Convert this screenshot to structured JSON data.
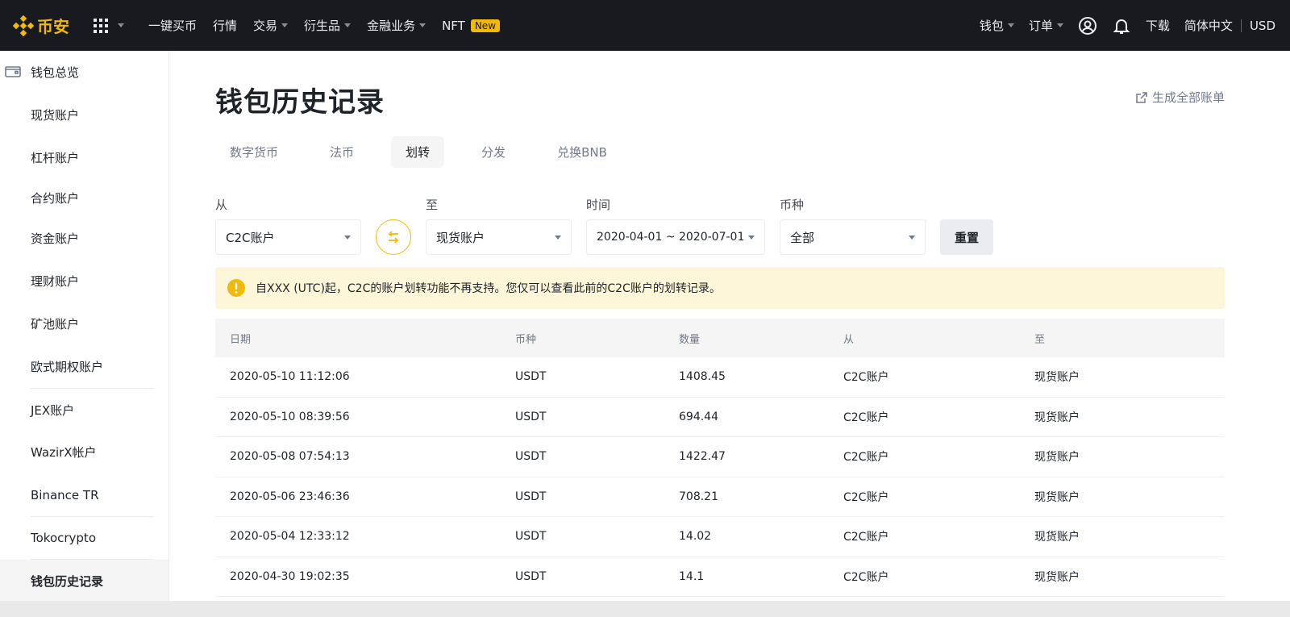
{
  "brand": {
    "name": "币安"
  },
  "topnav": {
    "left": [
      {
        "label": "一键买币",
        "dropdown": false
      },
      {
        "label": "行情",
        "dropdown": false
      },
      {
        "label": "交易",
        "dropdown": true
      },
      {
        "label": "衍生品",
        "dropdown": true
      },
      {
        "label": "金融业务",
        "dropdown": true
      },
      {
        "label": "NFT",
        "dropdown": false,
        "badge": "New"
      }
    ],
    "right": {
      "wallet": "钱包",
      "orders": "订单",
      "download": "下载",
      "language": "简体中文",
      "currency": "USD"
    }
  },
  "sidebar": {
    "items": [
      {
        "label": "钱包总览"
      },
      {
        "label": "现货账户"
      },
      {
        "label": "杠杆账户"
      },
      {
        "label": "合约账户"
      },
      {
        "label": "资金账户"
      },
      {
        "label": "理财账户"
      },
      {
        "label": "矿池账户"
      },
      {
        "label": "欧式期权账户"
      },
      {
        "label": "JEX账户"
      },
      {
        "label": "WazirX帐户"
      },
      {
        "label": "Binance TR"
      },
      {
        "label": "Tokocrypto"
      },
      {
        "label": "钱包历史记录"
      }
    ]
  },
  "page": {
    "title": "钱包历史记录",
    "export_label": "生成全部账单"
  },
  "tabs": [
    {
      "label": "数字货币"
    },
    {
      "label": "法币"
    },
    {
      "label": "划转",
      "active": true
    },
    {
      "label": "分发"
    },
    {
      "label": "兑换BNB"
    }
  ],
  "filters": {
    "from_label": "从",
    "from_value": "C2C账户",
    "to_label": "至",
    "to_value": "现货账户",
    "time_label": "时间",
    "time_value": "2020-04-01 ~ 2020-07-01",
    "coin_label": "币种",
    "coin_value": "全部",
    "reset_label": "重置"
  },
  "notice": {
    "text": "自XXX (UTC)起，C2C的账户划转功能不再支持。您仅可以查看此前的C2C账户的划转记录。"
  },
  "table": {
    "headers": [
      "日期",
      "币种",
      "数量",
      "从",
      "至"
    ],
    "rows": [
      [
        "2020-05-10 11:12:06",
        "USDT",
        "1408.45",
        "C2C账户",
        "现货账户"
      ],
      [
        "2020-05-10 08:39:56",
        "USDT",
        "694.44",
        "C2C账户",
        "现货账户"
      ],
      [
        "2020-05-08 07:54:13",
        "USDT",
        "1422.47",
        "C2C账户",
        "现货账户"
      ],
      [
        "2020-05-06 23:46:36",
        "USDT",
        "708.21",
        "C2C账户",
        "现货账户"
      ],
      [
        "2020-05-04 12:33:12",
        "USDT",
        "14.02",
        "C2C账户",
        "现货账户"
      ],
      [
        "2020-04-30 19:02:35",
        "USDT",
        "14.1",
        "C2C账户",
        "现货账户"
      ]
    ]
  },
  "colors": {
    "accent": "#f0b90b",
    "topbar": "#181a20",
    "notice_bg": "#fef6d8"
  }
}
